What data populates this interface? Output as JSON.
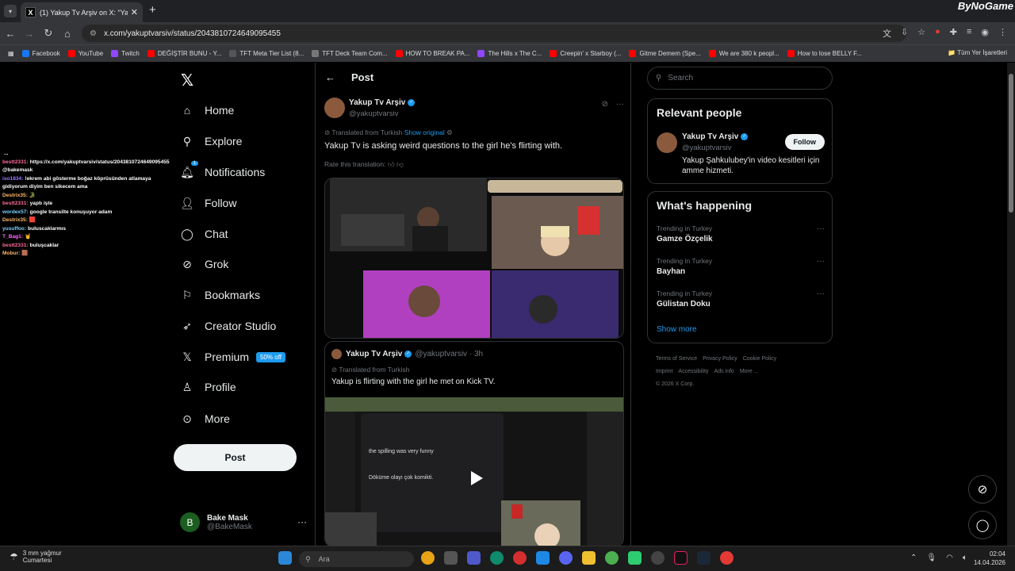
{
  "browser": {
    "tab_title": "(1) Yakup Tv Arşiv on X: \"Ya...",
    "tab_favicon": "X",
    "url": "x.com/yakuptvarsiv/status/2043810724649095455",
    "brand": "ByNoGame",
    "bookmarks": [
      {
        "label": "Facebook",
        "color": "#1877f2"
      },
      {
        "label": "YouTube",
        "color": "#ff0000"
      },
      {
        "label": "Twitch",
        "color": "#9146ff"
      },
      {
        "label": "DEĞİŞTİR BUNU - Y...",
        "color": "#ff0000"
      },
      {
        "label": "TFT Meta Tier List (8...",
        "color": "#555555"
      },
      {
        "label": "TFT Deck Team Com...",
        "color": "#777777"
      },
      {
        "label": "HOW TO BREAK PA...",
        "color": "#ff0000"
      },
      {
        "label": "The Hills x The C...",
        "color": "#9146ff"
      },
      {
        "label": "Creepin' x Starboy (...",
        "color": "#ff0000"
      },
      {
        "label": "Gitme Demem (Spe...",
        "color": "#ff0000"
      },
      {
        "label": "We are 380 k peopl...",
        "color": "#ff0000"
      },
      {
        "label": "How to lose BELLY F...",
        "color": "#ff0000"
      }
    ],
    "other_bookmarks": "Tüm Yer İşaretleri"
  },
  "chat": [
    {
      "user": "",
      "text": "...",
      "color": "#ffffff"
    },
    {
      "user": "bestt2331:",
      "text": "https://x.com/yakuptvarsiv/status/2043810724649095455 @bakemask",
      "color": "#ff6b9d"
    },
    {
      "user": "iso1834:",
      "text": "!ekrem abi gösterme boğaz köprüsünden atlamaya gidiyorum diyim ben sikecem ama",
      "color": "#9b7bff"
    },
    {
      "user": "Destrix35:",
      "text": "🐊",
      "color": "#ffb86b"
    },
    {
      "user": "bestt2331:",
      "text": "yapb işte",
      "color": "#ff6b9d"
    },
    {
      "user": "wordex57:",
      "text": "google transilte konuşuyor adam",
      "color": "#7bd3ff"
    },
    {
      "user": "Destrix35:",
      "text": "🟥",
      "color": "#ffb86b"
    },
    {
      "user": "yusuffoo:",
      "text": "buluscaklarmıs",
      "color": "#7bd3ff"
    },
    {
      "user": "T_Bag1:",
      "text": "🤘",
      "color": "#ff6bff"
    },
    {
      "user": "bestt2331:",
      "text": "buluşcaklar",
      "color": "#ff6b9d"
    },
    {
      "user": "Mobur:",
      "text": "🟫",
      "color": "#ffb86b"
    }
  ],
  "nav": {
    "items": [
      "Home",
      "Explore",
      "Notifications",
      "Follow",
      "Chat",
      "Grok",
      "Bookmarks",
      "Creator Studio",
      "Premium",
      "Profile",
      "More"
    ],
    "notification_count": "1",
    "premium_badge": "50% off",
    "post_label": "Post",
    "account_name": "Bake Mask",
    "account_handle": "@BakeMask",
    "account_initial": "B"
  },
  "main": {
    "title": "Post",
    "tweet": {
      "name": "Yakup Tv Arşiv",
      "handle": "@yakuptvarsiv",
      "translated_from": "Translated from Turkish",
      "show_original": "Show original",
      "text": "Yakup Tv is asking weird questions to the girl he's flirting with.",
      "rate": "Rate this translation:"
    },
    "quote": {
      "name": "Yakup Tv Arşiv",
      "handle": "@yakuptvarsiv · 3h",
      "translated_from": "Translated from Turkish",
      "text": "Yakup is flirting with the girl he met on Kick TV.",
      "video_caption_en": "the spilling was very funny",
      "video_caption_tr": "Döküme olayı çok komikti."
    }
  },
  "right": {
    "search_placeholder": "Search",
    "relevant_title": "Relevant people",
    "person": {
      "name": "Yakup Tv Arşiv",
      "handle": "@yakuptvarsiv",
      "bio": "Yakup Şahkulubey'in video kesitleri için amme hizmeti.",
      "follow": "Follow"
    },
    "happening_title": "What's happening",
    "trends": [
      {
        "context": "Trending in Turkey",
        "name": "Gamze Özçelik"
      },
      {
        "context": "Trending in Turkey",
        "name": "Bayhan"
      },
      {
        "context": "Trending in Turkey",
        "name": "Gülistan Doku"
      }
    ],
    "show_more": "Show more",
    "footer": [
      "Terms of Service",
      "Privacy Policy",
      "Cookie Policy",
      "Imprint",
      "Accessibility",
      "Ads info",
      "More ...",
      "© 2026 X Corp."
    ]
  },
  "taskbar": {
    "weather_temp": "3 mm yağmur",
    "weather_day": "Cumartesi",
    "search_placeholder": "Ara",
    "time": "02:04",
    "date": "14.04.2026"
  }
}
